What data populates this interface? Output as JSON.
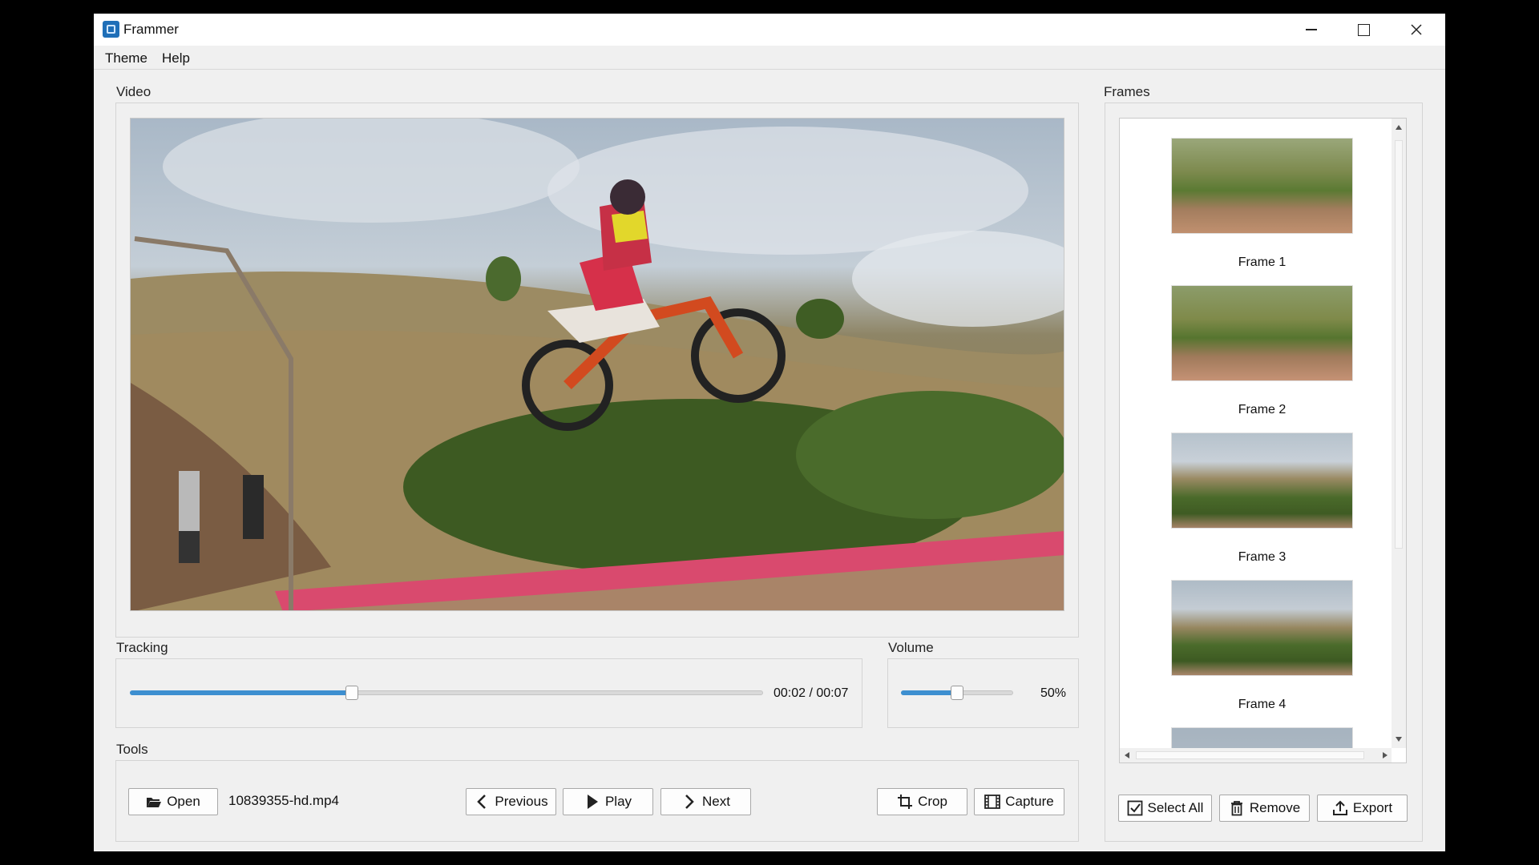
{
  "window": {
    "title": "Frammer"
  },
  "menu": {
    "theme": "Theme",
    "help": "Help"
  },
  "video": {
    "label": "Video"
  },
  "tracking": {
    "label": "Tracking",
    "time": "00:02 / 00:07",
    "progress": 0.35
  },
  "volume": {
    "label": "Volume",
    "value": "50%",
    "level": 0.5
  },
  "tools": {
    "label": "Tools",
    "open": "Open",
    "file_name": "10839355-hd.mp4",
    "previous": "Previous",
    "play": "Play",
    "next": "Next",
    "crop": "Crop",
    "capture": "Capture"
  },
  "frames": {
    "label": "Frames",
    "items": [
      "Frame 1",
      "Frame 2",
      "Frame 3",
      "Frame 4"
    ],
    "select_all": "Select All",
    "remove": "Remove",
    "export": "Export"
  },
  "icons": {
    "app": "app-icon",
    "open": "folder-icon",
    "previous": "chevron-left-icon",
    "play": "play-icon",
    "next": "chevron-right-icon",
    "crop": "crop-icon",
    "capture": "film-icon",
    "select_all": "checkbox-icon",
    "remove": "trash-icon",
    "export": "upload-icon"
  },
  "colors": {
    "accent": "#3d8fd0",
    "window_bg": "#f0f0f0"
  }
}
